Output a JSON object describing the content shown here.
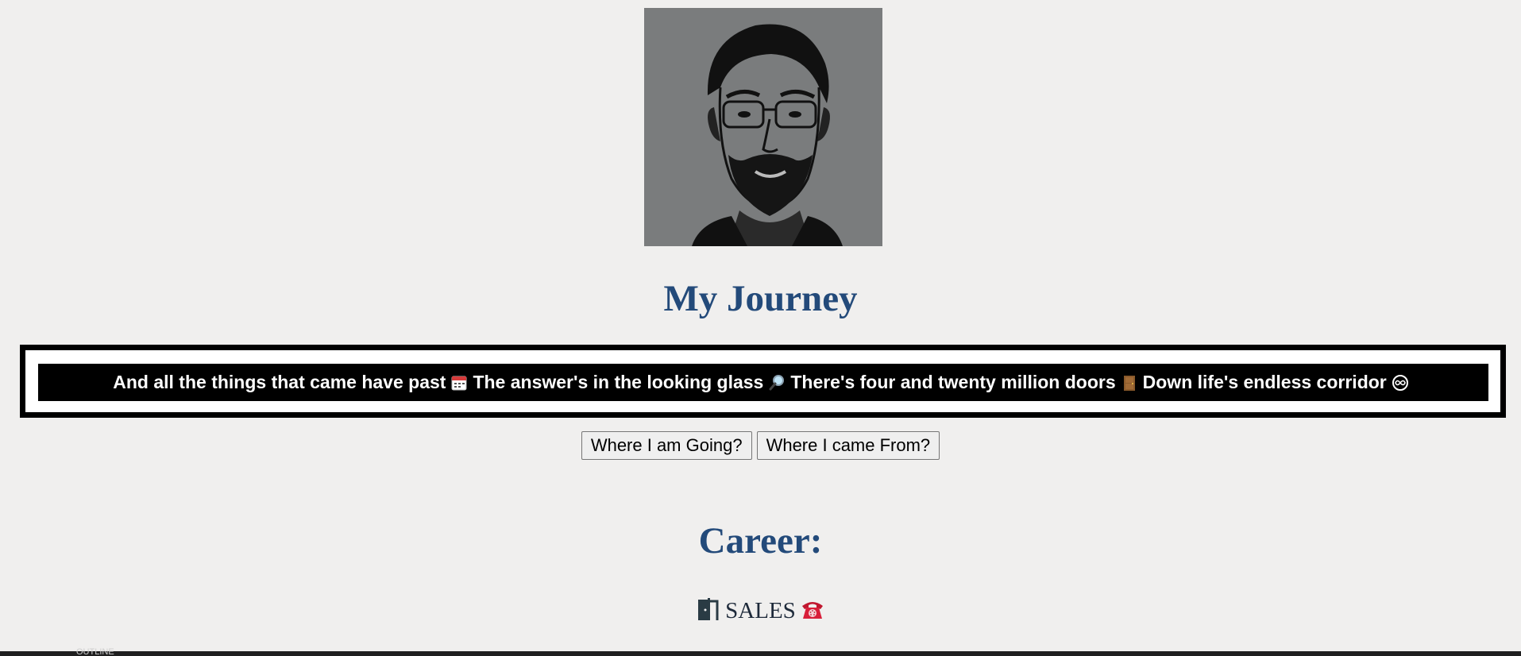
{
  "portrait": {
    "alt": "portrait"
  },
  "heading": "My Journey",
  "lyrics": [
    {
      "text": "And all the things that came have past",
      "emoji": "calendar-icon"
    },
    {
      "text": "The answer's in the looking glass",
      "emoji": "magnifying-glass-icon"
    },
    {
      "text": "There's four and twenty million doors",
      "emoji": "door-icon"
    },
    {
      "text": "Down life's endless corridor",
      "emoji": "infinity-icon"
    }
  ],
  "buttons": {
    "going": "Where I am Going?",
    "came_from": "Where I came From?"
  },
  "career": {
    "title": "Career:",
    "item": "SALES",
    "left_icon": "door-exit-icon",
    "right_icon": "telephone-icon"
  },
  "footer": {
    "label": "OUTLINE"
  }
}
